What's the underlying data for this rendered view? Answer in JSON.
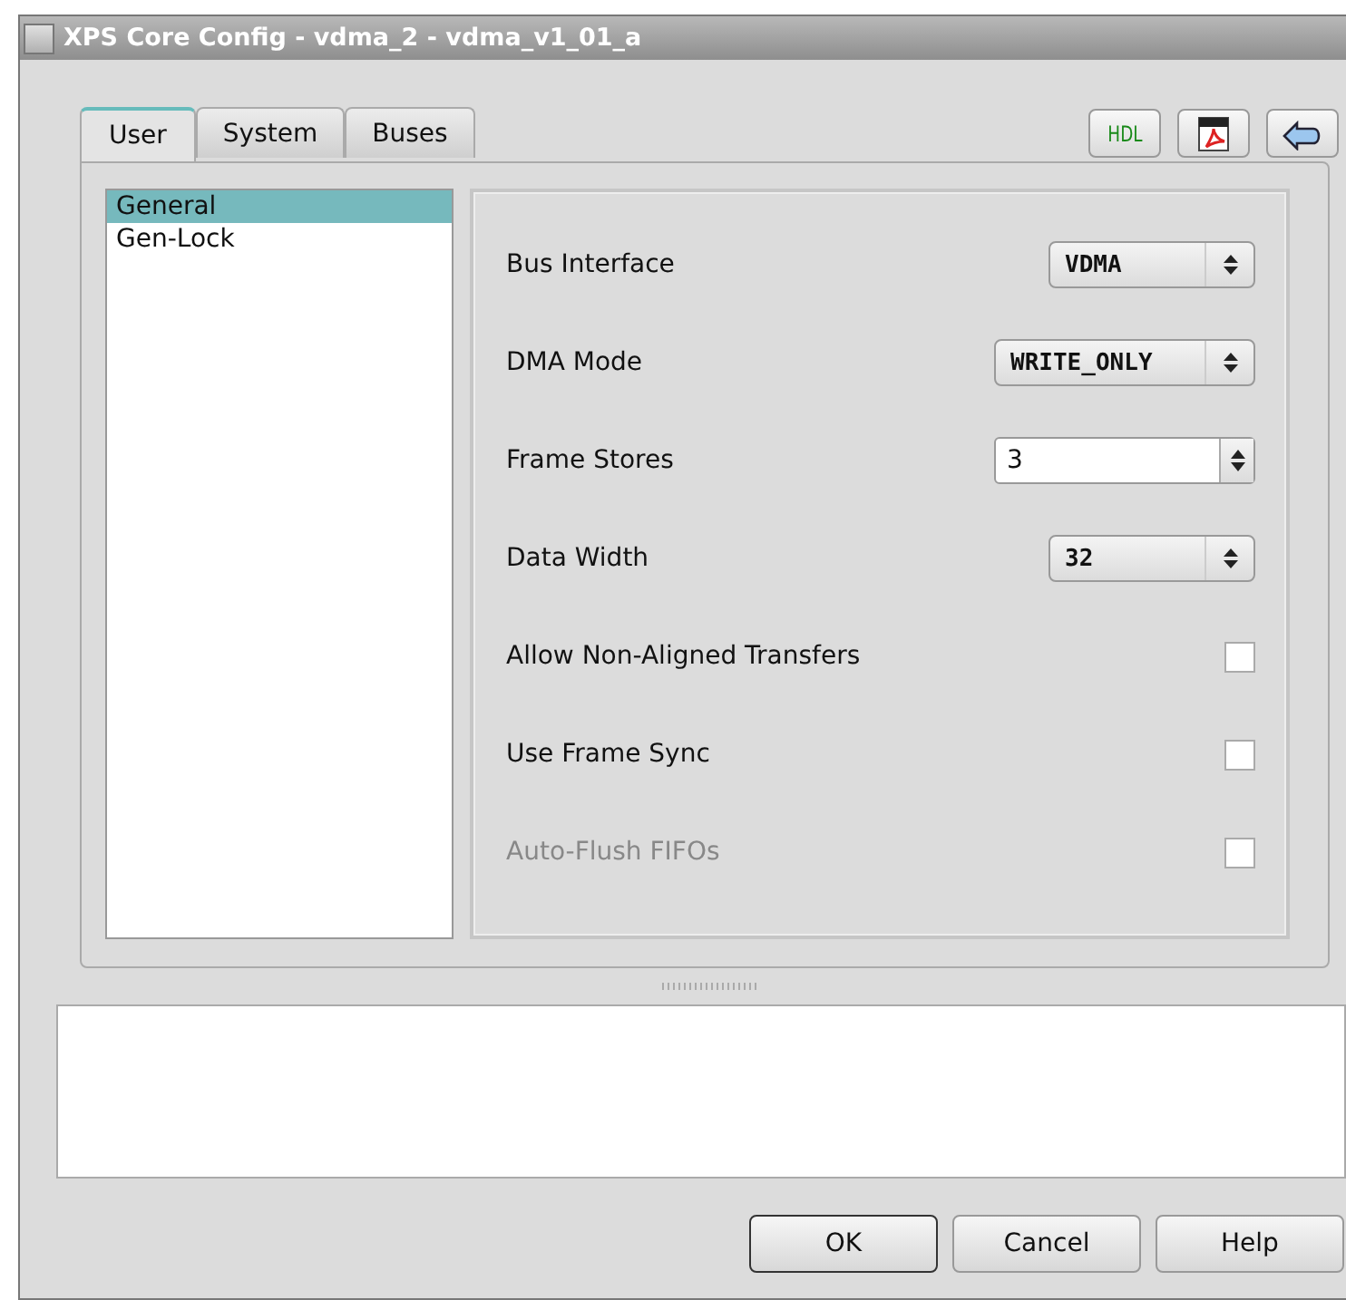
{
  "window": {
    "title": "XPS Core Config - vdma_2 - vdma_v1_01_a"
  },
  "tabs": [
    {
      "label": "User",
      "selected": true
    },
    {
      "label": "System",
      "selected": false
    },
    {
      "label": "Buses",
      "selected": false
    }
  ],
  "toolbar": [
    {
      "kind": "hdl",
      "label": "HDL"
    },
    {
      "kind": "pdf"
    },
    {
      "kind": "back"
    }
  ],
  "categories": [
    {
      "label": "General",
      "selected": true
    },
    {
      "label": "Gen-Lock",
      "selected": false
    }
  ],
  "params": [
    {
      "kind": "select",
      "label": "Bus Interface",
      "value": "VDMA",
      "disabled": false
    },
    {
      "kind": "select",
      "label": "DMA Mode",
      "value": "WRITE_ONLY",
      "disabled": false
    },
    {
      "kind": "spin",
      "label": "Frame Stores",
      "value": "3",
      "disabled": false
    },
    {
      "kind": "select",
      "label": "Data Width",
      "value": "32",
      "disabled": false
    },
    {
      "kind": "check",
      "label": "Allow Non-Aligned Transfers",
      "checked": false,
      "disabled": false
    },
    {
      "kind": "check",
      "label": "Use Frame Sync",
      "checked": false,
      "disabled": false
    },
    {
      "kind": "check",
      "label": "Auto-Flush FIFOs",
      "checked": false,
      "disabled": true
    }
  ],
  "buttons": [
    {
      "label": "OK",
      "default": true
    },
    {
      "label": "Cancel",
      "default": false
    },
    {
      "label": "Help",
      "default": false
    }
  ]
}
